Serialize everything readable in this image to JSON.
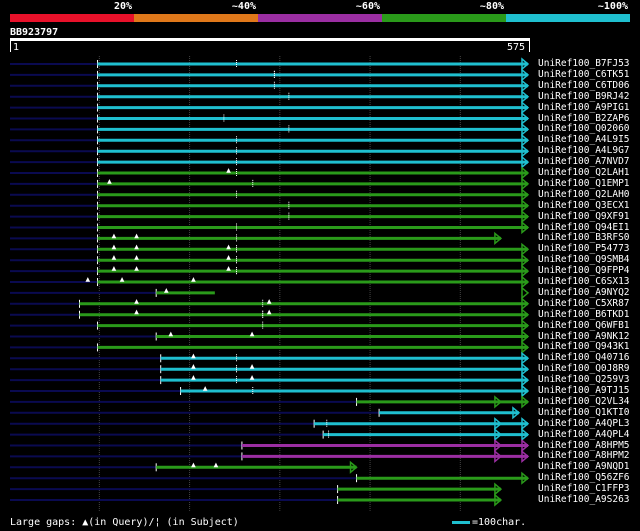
{
  "scale": {
    "segments": [
      {
        "label": "20%",
        "color": "#e8112a"
      },
      {
        "label": "~40%",
        "color": "#e0781a"
      },
      {
        "label": "~60%",
        "color": "#9b2ea2"
      },
      {
        "label": "~80%",
        "color": "#2a9a1a"
      },
      {
        "label": "~100%",
        "color": "#1fbfcf"
      }
    ]
  },
  "query": {
    "name": "BB923797",
    "start_label": "1",
    "end_label": "575",
    "length": 575
  },
  "colors": {
    "cyan": "#1fbfcf",
    "green": "#2a9a1a",
    "purple": "#9b2ea2",
    "navy": "#0a0a50",
    "gridline": "#444444"
  },
  "hits": [
    {
      "name": "UniRef100_B7FJ53",
      "color": "cyan",
      "start": 98,
      "end": 575,
      "arrow": "end",
      "gaps_q": [],
      "gaps_s": [
        252
      ]
    },
    {
      "name": "UniRef100_C6TK51",
      "color": "cyan",
      "start": 98,
      "end": 575,
      "arrow": "none",
      "gaps_q": [],
      "gaps_s": [
        294,
        294
      ]
    },
    {
      "name": "UniRef100_C6TD06",
      "color": "cyan",
      "start": 98,
      "end": 575,
      "arrow": "none",
      "gaps_q": [],
      "gaps_s": [
        294
      ]
    },
    {
      "name": "UniRef100_B9RJ42",
      "color": "cyan",
      "start": 98,
      "end": 575,
      "arrow": "none",
      "gaps_q": [],
      "gaps_s": [
        310
      ]
    },
    {
      "name": "UniRef100_A9PIG1",
      "color": "cyan",
      "start": 98,
      "end": 575,
      "arrow": "none",
      "gaps_q": [],
      "gaps_s": []
    },
    {
      "name": "UniRef100_B2ZAP6",
      "color": "cyan",
      "start": 98,
      "end": 575,
      "arrow": "none",
      "gaps_q": [],
      "gaps_s": [
        238
      ]
    },
    {
      "name": "UniRef100_Q02060",
      "color": "cyan",
      "start": 98,
      "end": 575,
      "arrow": "none",
      "gaps_q": [],
      "gaps_s": [
        310
      ]
    },
    {
      "name": "UniRef100_A4L9I5",
      "color": "cyan",
      "start": 98,
      "end": 575,
      "arrow": "none",
      "gaps_q": [],
      "gaps_s": [
        252
      ]
    },
    {
      "name": "UniRef100_A4L9G7",
      "color": "cyan",
      "start": 98,
      "end": 575,
      "arrow": "none",
      "gaps_q": [],
      "gaps_s": [
        252
      ]
    },
    {
      "name": "UniRef100_A7NVD7",
      "color": "cyan",
      "start": 98,
      "end": 575,
      "arrow": "none",
      "gaps_q": [],
      "gaps_s": [
        252
      ]
    },
    {
      "name": "UniRef100_Q2LAH1",
      "color": "green",
      "start": 98,
      "end": 575,
      "arrow": "none",
      "gaps_q": [
        244
      ],
      "gaps_s": [
        252
      ]
    },
    {
      "name": "UniRef100_Q1EMP1",
      "color": "green",
      "start": 98,
      "end": 575,
      "arrow": "none",
      "gaps_q": [
        112
      ],
      "gaps_s": [
        270
      ]
    },
    {
      "name": "UniRef100_Q2LAH0",
      "color": "green",
      "start": 98,
      "end": 575,
      "arrow": "none",
      "gaps_q": [],
      "gaps_s": [
        252
      ]
    },
    {
      "name": "UniRef100_Q3ECX1",
      "color": "green",
      "start": 98,
      "end": 575,
      "arrow": "none",
      "gaps_q": [],
      "gaps_s": [
        310
      ]
    },
    {
      "name": "UniRef100_Q9XF91",
      "color": "green",
      "start": 98,
      "end": 575,
      "arrow": "none",
      "gaps_q": [],
      "gaps_s": [
        310
      ]
    },
    {
      "name": "UniRef100_Q94EI1",
      "color": "green",
      "start": 98,
      "end": 575,
      "arrow": "none",
      "gaps_q": [],
      "gaps_s": [
        252
      ]
    },
    {
      "name": "UniRef100_B3RFS0",
      "color": "green",
      "start": 98,
      "end": 545,
      "arrow": "end",
      "gaps_q": [
        117,
        142
      ],
      "gaps_s": [
        252
      ]
    },
    {
      "name": "UniRef100_P54773",
      "color": "green",
      "start": 98,
      "end": 575,
      "arrow": "none",
      "gaps_q": [
        117,
        142,
        244
      ],
      "gaps_s": [
        252,
        252
      ]
    },
    {
      "name": "UniRef100_Q9SMB4",
      "color": "green",
      "start": 98,
      "end": 575,
      "arrow": "none",
      "gaps_q": [
        117,
        142,
        244
      ],
      "gaps_s": [
        252,
        252
      ]
    },
    {
      "name": "UniRef100_Q9FPP4",
      "color": "green",
      "start": 98,
      "end": 575,
      "arrow": "none",
      "gaps_q": [
        117,
        142,
        244
      ],
      "gaps_s": [
        252,
        252
      ]
    },
    {
      "name": "UniRef100_C6SX13",
      "color": "green",
      "start": 98,
      "end": 575,
      "arrow": "none",
      "gaps_q": [
        88,
        126,
        205
      ],
      "gaps_s": []
    },
    {
      "name": "UniRef100_A9NYQ2",
      "color": "green",
      "start": 163,
      "end": 228,
      "arrow": "none",
      "gaps_q": [
        175
      ],
      "gaps_s": []
    },
    {
      "name": "UniRef100_C5XR87",
      "color": "green",
      "start": 78,
      "end": 575,
      "arrow": "none",
      "gaps_q": [
        142,
        289
      ],
      "gaps_s": [
        281
      ]
    },
    {
      "name": "UniRef100_B6TKD1",
      "color": "green",
      "start": 78,
      "end": 575,
      "arrow": "none",
      "gaps_q": [
        142,
        289
      ],
      "gaps_s": [
        281,
        281
      ]
    },
    {
      "name": "UniRef100_Q6WFB1",
      "color": "green",
      "start": 98,
      "end": 575,
      "arrow": "none",
      "gaps_q": [],
      "gaps_s": [
        281
      ]
    },
    {
      "name": "UniRef100_A9NK12",
      "color": "green",
      "start": 163,
      "end": 575,
      "arrow": "none",
      "gaps_q": [
        180,
        270
      ],
      "gaps_s": []
    },
    {
      "name": "UniRef100_Q943K1",
      "color": "green",
      "start": 98,
      "end": 575,
      "arrow": "none",
      "gaps_q": [],
      "gaps_s": []
    },
    {
      "name": "UniRef100_Q40716",
      "color": "cyan",
      "start": 168,
      "end": 575,
      "arrow": "none",
      "gaps_q": [
        205
      ],
      "gaps_s": [
        252
      ]
    },
    {
      "name": "UniRef100_Q0J8R9",
      "color": "cyan",
      "start": 168,
      "end": 575,
      "arrow": "none",
      "gaps_q": [
        205,
        270
      ],
      "gaps_s": [
        252,
        252
      ]
    },
    {
      "name": "UniRef100_Q259V3",
      "color": "cyan",
      "start": 168,
      "end": 575,
      "arrow": "none",
      "gaps_q": [
        205,
        270
      ],
      "gaps_s": [
        252
      ]
    },
    {
      "name": "UniRef100_A9TJ15",
      "color": "cyan",
      "start": 190,
      "end": 575,
      "arrow": "none",
      "gaps_q": [
        218
      ],
      "gaps_s": [
        270
      ]
    },
    {
      "name": "UniRef100_Q2VL34",
      "color": "green",
      "start": 385,
      "end": 575,
      "arrow": "mid",
      "gaps_q": [],
      "gaps_s": []
    },
    {
      "name": "UniRef100_Q1KTI0",
      "color": "cyan",
      "start": 410,
      "end": 565,
      "arrow": "end",
      "gaps_q": [],
      "gaps_s": []
    },
    {
      "name": "UniRef100_A4QPL3",
      "color": "cyan",
      "start": 338,
      "end": 575,
      "arrow": "mid",
      "gaps_q": [],
      "gaps_s": [
        352
      ]
    },
    {
      "name": "UniRef100_A4QPL4",
      "color": "cyan",
      "start": 348,
      "end": 575,
      "arrow": "mid",
      "gaps_q": [],
      "gaps_s": [
        354
      ]
    },
    {
      "name": "UniRef100_A8HPM5",
      "color": "purple",
      "start": 258,
      "end": 575,
      "arrow": "mid",
      "gaps_q": [],
      "gaps_s": []
    },
    {
      "name": "UniRef100_A8HPM2",
      "color": "purple",
      "start": 258,
      "end": 575,
      "arrow": "mid",
      "gaps_q": [],
      "gaps_s": []
    },
    {
      "name": "UniRef100_A9NQD1",
      "color": "green",
      "start": 163,
      "end": 385,
      "arrow": "end",
      "gaps_q": [
        205,
        230
      ],
      "gaps_s": []
    },
    {
      "name": "UniRef100_Q56ZF6",
      "color": "green",
      "start": 385,
      "end": 575,
      "arrow": "none",
      "gaps_q": [],
      "gaps_s": []
    },
    {
      "name": "UniRef100_C1FFP3",
      "color": "green",
      "start": 364,
      "end": 545,
      "arrow": "end",
      "gaps_q": [],
      "gaps_s": []
    },
    {
      "name": "UniRef100_A9S263",
      "color": "green",
      "start": 364,
      "end": 545,
      "arrow": "end",
      "gaps_q": [],
      "gaps_s": []
    }
  ],
  "footer": {
    "legend_text": "Large gaps: ▲(in Query)/¦ (in Subject)",
    "scale_text": "=100char."
  }
}
